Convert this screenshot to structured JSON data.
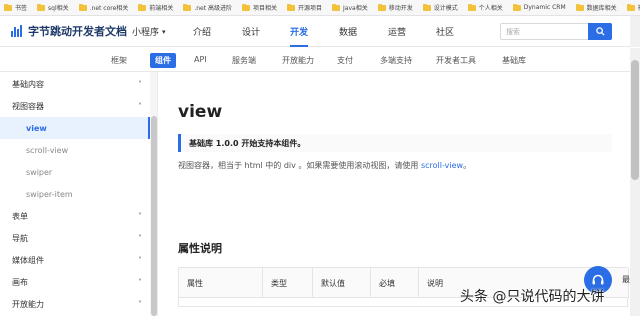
{
  "bookmarks": [
    {
      "label": "书签",
      "icon": "folder-icon"
    },
    {
      "label": "sql相关",
      "icon": "folder-icon"
    },
    {
      "label": ".net core相关",
      "icon": "folder-icon"
    },
    {
      "label": "前端相关",
      "icon": "folder-icon"
    },
    {
      "label": ".net 高级进阶",
      "icon": "folder-icon"
    },
    {
      "label": "项目相关",
      "icon": "folder-icon"
    },
    {
      "label": "开源项目",
      "icon": "folder-icon"
    },
    {
      "label": "Java相关",
      "icon": "folder-icon"
    },
    {
      "label": "移动开发",
      "icon": "folder-icon"
    },
    {
      "label": "设计模式",
      "icon": "folder-icon"
    },
    {
      "label": "个人相关",
      "icon": "folder-icon"
    },
    {
      "label": "Dynamic CRM",
      "icon": "folder-icon"
    },
    {
      "label": "数据库相关",
      "icon": "folder-icon"
    },
    {
      "label": "社区",
      "icon": "folder-icon"
    }
  ],
  "header": {
    "logo_text": "字节跳动开发者文档",
    "product_select": "小程序",
    "nav": [
      {
        "label": "介绍",
        "active": false
      },
      {
        "label": "设计",
        "active": false
      },
      {
        "label": "开发",
        "active": true
      },
      {
        "label": "数据",
        "active": false
      },
      {
        "label": "运营",
        "active": false
      },
      {
        "label": "社区",
        "active": false
      }
    ],
    "search_placeholder": "搜索"
  },
  "subnav": [
    {
      "label": "框架",
      "active": false
    },
    {
      "label": "组件",
      "active": true
    },
    {
      "label": "API",
      "active": false
    },
    {
      "label": "服务端",
      "active": false
    },
    {
      "label": "开放能力",
      "active": false
    },
    {
      "label": "支付",
      "active": false
    },
    {
      "label": "多端支持",
      "active": false
    },
    {
      "label": "开发者工具",
      "active": false
    },
    {
      "label": "基础库",
      "active": false
    }
  ],
  "sidebar": {
    "items": [
      {
        "label": "基础内容",
        "type": "group",
        "chevron": "chevron-down-icon"
      },
      {
        "label": "视图容器",
        "type": "group",
        "chevron": "chevron-up-icon"
      },
      {
        "label": "view",
        "type": "sub",
        "active": true
      },
      {
        "label": "scroll-view",
        "type": "sub",
        "active": false
      },
      {
        "label": "swiper",
        "type": "sub",
        "active": false
      },
      {
        "label": "swiper-item",
        "type": "sub",
        "active": false
      },
      {
        "label": "表单",
        "type": "group",
        "chevron": "chevron-down-icon"
      },
      {
        "label": "导航",
        "type": "group",
        "chevron": "chevron-down-icon"
      },
      {
        "label": "媒体组件",
        "type": "group",
        "chevron": "chevron-down-icon"
      },
      {
        "label": "画布",
        "type": "group",
        "chevron": "chevron-down-icon"
      },
      {
        "label": "开放能力",
        "type": "group",
        "chevron": "chevron-down-icon"
      }
    ]
  },
  "content": {
    "title": "view",
    "note": "基础库 1.0.0 开始支持本组件。",
    "desc_text": "视图容器，相当于 html 中的 div 。如果需要使用滚动视图，请使用",
    "desc_link": "scroll-view",
    "desc_end": "。",
    "section_title": "属性说明",
    "table_headers": [
      "属性",
      "类型",
      "默认值",
      "必填",
      "说明"
    ]
  },
  "side_tag": "最",
  "watermark": "头条 @只说代码的大饼",
  "colors": {
    "accent": "#2b6de5",
    "folder": "#f2c23a"
  }
}
